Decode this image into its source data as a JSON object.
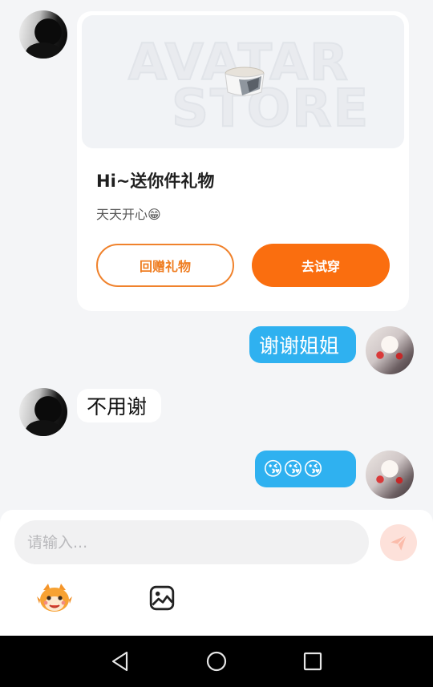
{
  "gift_card": {
    "banner_line1": "AVATAR",
    "banner_line2": "STORE",
    "title": "Hi~送你件礼物",
    "subtitle": "天天开心😁",
    "return_gift_label": "回赠礼物",
    "try_on_label": "去试穿"
  },
  "messages": [
    {
      "from": "me",
      "text": "谢谢姐姐"
    },
    {
      "from": "other",
      "text": "不用谢"
    },
    {
      "from": "me",
      "text": "😘😘😘"
    }
  ],
  "input": {
    "placeholder": "请输入...",
    "value": ""
  },
  "toolbar": {
    "icons": [
      "mascot-sticker-icon",
      "image-icon"
    ]
  },
  "colors": {
    "accent_orange": "#fa6e0f",
    "bubble_blue": "#2fb1f0",
    "send_button_bg": "#fde1da"
  }
}
